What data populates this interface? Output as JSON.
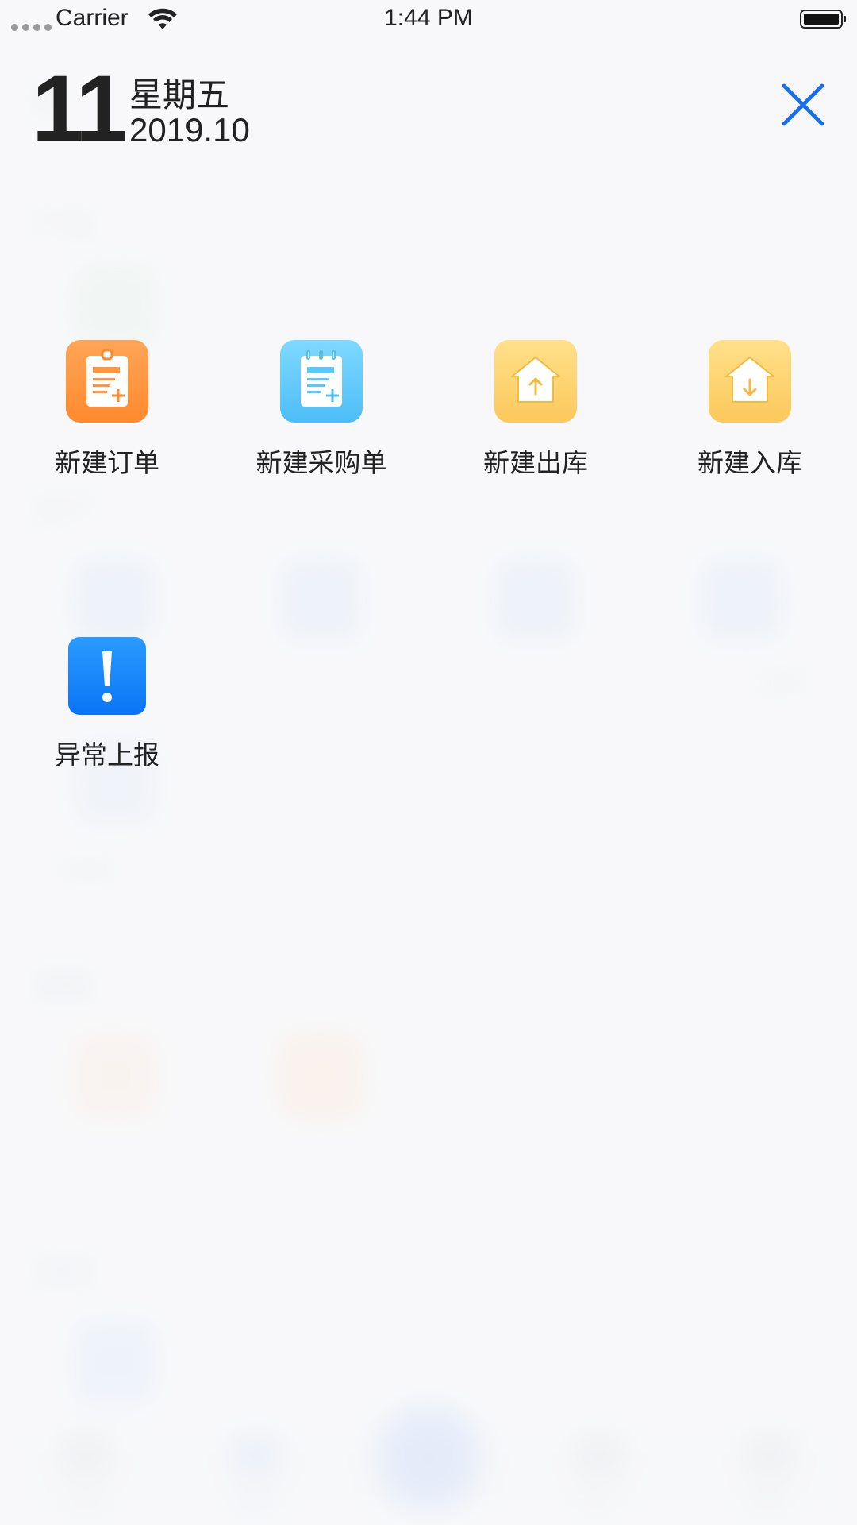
{
  "status_bar": {
    "carrier": "Carrier",
    "time": "1:44 PM"
  },
  "date": {
    "day": "11",
    "weekday": "星期五",
    "year_month": "2019.10"
  },
  "actions": [
    {
      "label": "新建订单",
      "icon": "new-order-icon",
      "color": "#ff9640"
    },
    {
      "label": "新建采购单",
      "icon": "new-purchase-icon",
      "color": "#5cc8fa"
    },
    {
      "label": "新建出库",
      "icon": "outbound-icon",
      "color": "#fdd270"
    },
    {
      "label": "新建入库",
      "icon": "inbound-icon",
      "color": "#fdd270"
    },
    {
      "label": "异常上报",
      "icon": "exception-report-icon",
      "color": "#0f7ff5"
    }
  ],
  "background": {
    "sections": [
      "产品",
      "生产",
      "销售",
      "采购"
    ],
    "partial_labels": [
      "记录",
      "异常"
    ],
    "tabs": [
      "任务",
      "菜单",
      "统计",
      "我的"
    ],
    "active_tab": "菜单"
  },
  "colors": {
    "accent": "#1a6fe8"
  }
}
